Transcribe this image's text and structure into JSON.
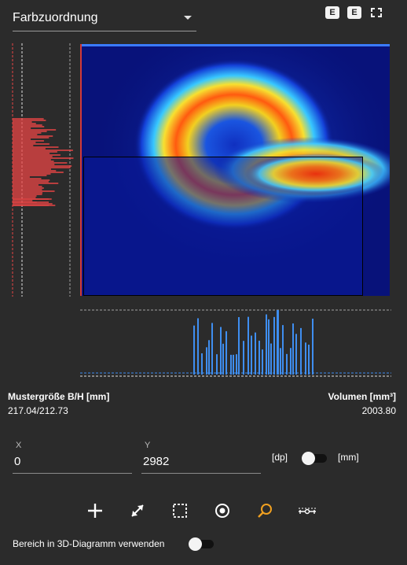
{
  "header": {
    "dropdown_label": "Farbzuordnung",
    "icon_1_letter": "E",
    "icon_2_letter": "E"
  },
  "stats": {
    "size_label": "Mustergröße B/H [mm]",
    "size_value": "217.04/212.73",
    "volume_label": "Volumen [mm³]",
    "volume_value": "2003.80"
  },
  "coords": {
    "x_label": "X",
    "x_value": "0",
    "y_label": "Y",
    "y_value": "2982"
  },
  "units": {
    "left": "[dp]",
    "right": "[mm]",
    "toggle_on": false
  },
  "tools": [
    {
      "name": "crosshair-icon"
    },
    {
      "name": "line-measure-icon"
    },
    {
      "name": "rectangle-select-icon"
    },
    {
      "name": "target-icon"
    },
    {
      "name": "zoom-icon",
      "active": true
    },
    {
      "name": "ruler-icon"
    }
  ],
  "footer": {
    "use_in_3d_label": "Bereich in 3D-Diagramm verwenden",
    "toggle_on": false
  },
  "colors": {
    "background": "#2b2b2b",
    "histogram_left": "#e84545",
    "histogram_bottom": "#3f8ef0",
    "active_tool": "#f0a020"
  }
}
